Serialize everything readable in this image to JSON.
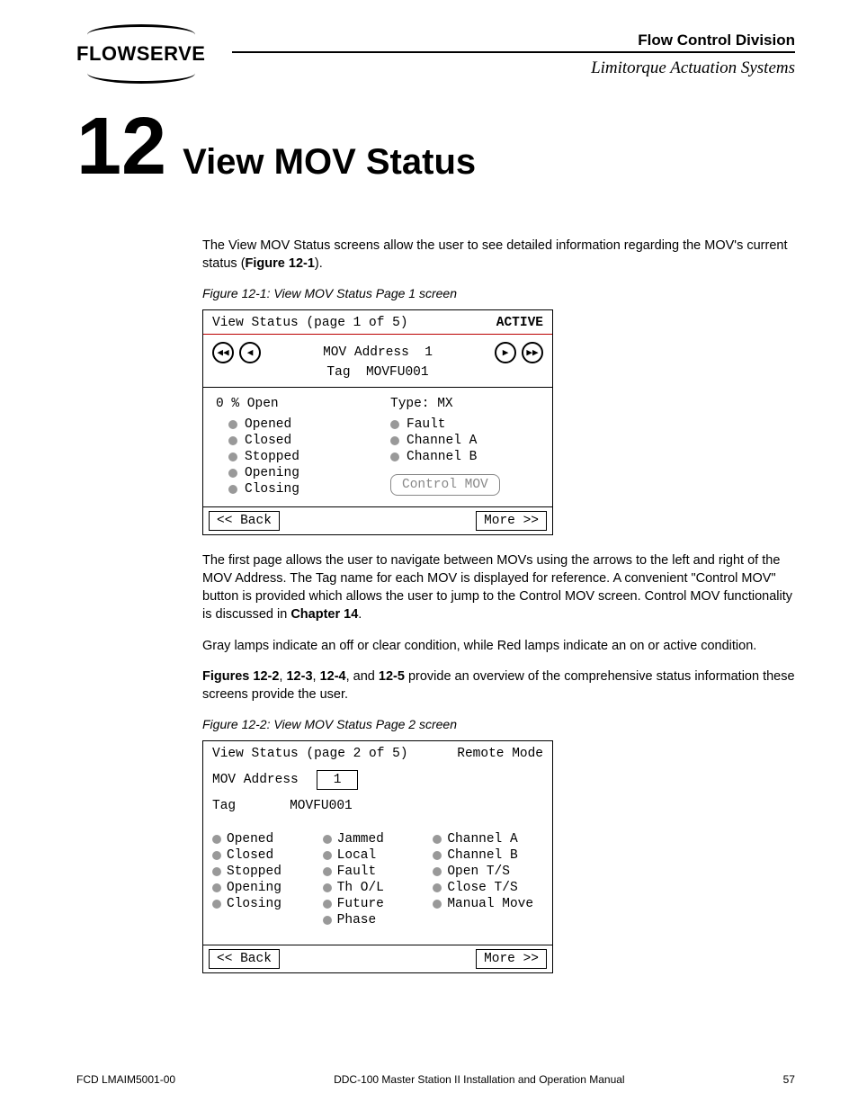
{
  "header": {
    "logo": "FLOWSERVE",
    "division": "Flow Control Division",
    "subtitle": "Limitorque Actuation Systems"
  },
  "chapter": {
    "num": "12",
    "title": "View MOV Status"
  },
  "p1a": "The View MOV Status screens allow the user to see detailed information regarding the MOV's current status (",
  "p1b": "Figure 12-1",
  "p1c": ").",
  "fig1_caption": "Figure 12-1: View MOV Status Page 1 screen",
  "panel1": {
    "title": "View Status (page 1 of 5)",
    "status": "ACTIVE",
    "nav_first": "◀◀",
    "nav_prev": "◀",
    "nav_next": "▶",
    "nav_last": "▶▶",
    "addr_label": "MOV Address",
    "addr_val": "1",
    "tag_label": "Tag",
    "tag_val": "MOVFU001",
    "open_pct": "0 % Open",
    "type": "Type: MX",
    "left_lamps": [
      "Opened",
      "Closed",
      "Stopped",
      "Opening",
      "Closing"
    ],
    "right_lamps": [
      "Fault",
      "Channel A",
      "Channel B"
    ],
    "control_btn": "Control MOV",
    "back": "<< Back",
    "more": "More >>"
  },
  "p2a": "The first page allows the user to navigate between MOVs using the arrows to the left and right of the MOV Address. The Tag name for each MOV is displayed for reference. A convenient \"Control MOV\" button is provided which allows the user to jump to the Control MOV screen. Control MOV functionality is discussed in ",
  "p2b": "Chapter 14",
  "p2c": ".",
  "p3": "Gray lamps indicate an off or clear condition, while Red lamps indicate an on or active condition.",
  "p4a": "Figures 12-2",
  "p4b": ", ",
  "p4c": "12-3",
  "p4d": ", ",
  "p4e": "12-4",
  "p4f": ", and ",
  "p4g": "12-5",
  "p4h": " provide an overview of the comprehensive status information these screens provide the user.",
  "fig2_caption": "Figure 12-2: View MOV Status Page 2 screen",
  "panel2": {
    "title": "View Status (page 2 of 5)",
    "mode": "Remote Mode",
    "addr_label": "MOV Address",
    "addr_val": "1",
    "tag_label": "Tag",
    "tag_val": "MOVFU001",
    "col1": [
      "Opened",
      "Closed",
      "Stopped",
      "Opening",
      "Closing"
    ],
    "col2": [
      "Jammed",
      "Local",
      "Fault",
      "Th O/L",
      "Future",
      "Phase"
    ],
    "col3": [
      "Channel A",
      "Channel B",
      "Open T/S",
      "Close T/S",
      "Manual Move"
    ],
    "back": "<< Back",
    "more": "More >>"
  },
  "footer": {
    "left": "FCD LMAIM5001-00",
    "center": "DDC-100 Master Station II Installation and Operation Manual",
    "right": "57"
  }
}
